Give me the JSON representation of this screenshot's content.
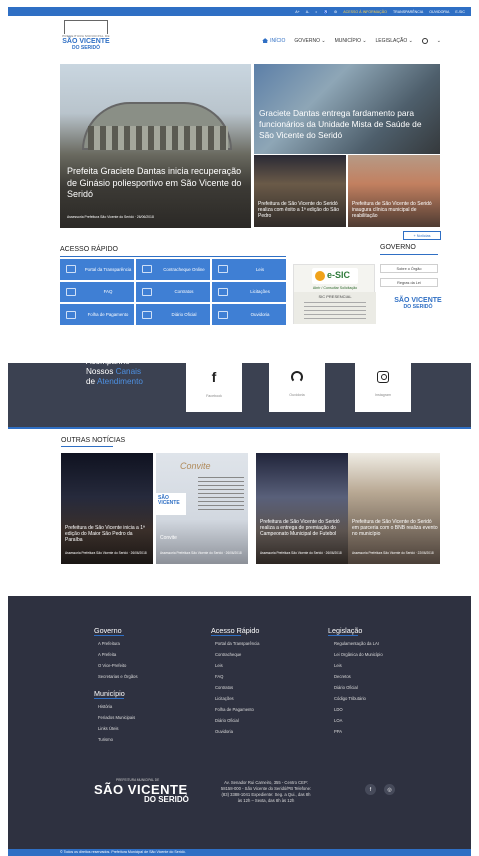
{
  "topbar": {
    "items": [
      "A+",
      "A-",
      "◐",
      "♿",
      "⚙"
    ],
    "links": [
      "ACESSO À INFORMAÇÃO",
      "TRANSPARÊNCIA",
      "OUVIDORIA",
      "E-SIC"
    ]
  },
  "header": {
    "logo_small": "PREFEITURA MUNICIPAL DE",
    "logo_main": "SÃO VICENTE",
    "logo_sub": "DO SERIDÓ",
    "nav": [
      {
        "label": "INÍCIO"
      },
      {
        "label": "GOVERNO ⌄"
      },
      {
        "label": "MUNICÍPIO ⌄"
      },
      {
        "label": "LEGISLAÇÃO ⌄"
      }
    ],
    "search_more": "⌄"
  },
  "hero": {
    "main": {
      "title": "Prefeita Graciete Dantas inicia recuperação de Ginásio poliesportivo em São Vicente do Seridó",
      "meta": "Assessoria Prefeitura São Vicente do Seridó · 26/06/2018"
    },
    "top_right": {
      "title": "Graciete Dantas entrega fardamento para funcionários da Unidade Mista de Saúde de São Vicente do Seridó"
    },
    "small": [
      {
        "title": "Prefeitura de São Vicente do Seridó realiza com êxito a 1ª edição do São Pedro"
      },
      {
        "title": "Prefeitura de São Vicente do Seridó inaugura clínica municipal de reabilitação"
      }
    ],
    "more_button": "+ Notícias"
  },
  "quick_access": {
    "title": "ACESSO RÁPIDO",
    "items": [
      {
        "label": "Portal da Transparência",
        "icon": "search-icon"
      },
      {
        "label": "Contracheque Online",
        "icon": "document-icon"
      },
      {
        "label": "Leis",
        "icon": "book-icon"
      },
      {
        "label": "FAQ",
        "icon": "chat-icon"
      },
      {
        "label": "Contratos",
        "icon": "contract-icon"
      },
      {
        "label": "Licitações",
        "icon": "gavel-icon"
      },
      {
        "label": "Folha de Pagamento",
        "icon": "payroll-icon"
      },
      {
        "label": "Diário Oficial",
        "icon": "newspaper-icon"
      },
      {
        "label": "Ouvidoria",
        "icon": "headset-icon"
      }
    ]
  },
  "esic": {
    "logo": "e-SIC",
    "caption": "Abrir / Consultar Solicitação",
    "presencial_title": "SIC PRESENCIAL"
  },
  "governo": {
    "title": "GOVERNO",
    "buttons": [
      "Sobre o Órgão",
      "Regras da Lei"
    ],
    "logo_main": "SÃO VICENTE",
    "logo_sub": "DO SERIDÓ"
  },
  "social": {
    "line1": "Acompanhe",
    "line2_a": "Nossos ",
    "line2_b": "Canais",
    "line3_a": "de ",
    "line3_b": "Atendimento",
    "channels": [
      {
        "glyph": "f",
        "label": "Facebook",
        "icon": "facebook-icon"
      },
      {
        "glyph": "",
        "label": "Ouvidoria",
        "icon": "podcast-icon"
      },
      {
        "glyph": "",
        "label": "Instagram",
        "icon": "instagram-icon"
      }
    ]
  },
  "outras": {
    "title": "OUTRAS NOTÍCIAS",
    "cards": [
      {
        "title": "Prefeitura de São Vicente inicia a 1ª edição do Maior São Pedro da Paraíba",
        "meta": "Assessoria Prefeitura São Vicente do Seridó · 26/06/2018"
      },
      {
        "title": "Convite",
        "meta": "Assessoria Prefeitura São Vicente do Seridó · 26/06/2018",
        "invite": "Convite"
      },
      {
        "title": "Prefeitura de São Vicente do Seridó realiza a entrega de premiação do Campeonato Municipal de Futebol",
        "meta": "Assessoria Prefeitura São Vicente do Seridó · 26/06/2018"
      },
      {
        "title": "Prefeitura de São Vicente do Seridó em parceria com o BNB realiza evento no município",
        "meta": "Assessoria Prefeitura São Vicente do Seridó · 22/06/2018"
      }
    ]
  },
  "footer": {
    "governo": {
      "title": "Governo",
      "links": [
        "A Prefeitura",
        "A Prefeita",
        "O Vice-Prefeito",
        "Secretarias e Órgãos"
      ]
    },
    "municipio": {
      "title": "Município",
      "links": [
        "História",
        "Feriados Municipais",
        "Links Úteis",
        "Turismo"
      ]
    },
    "acesso": {
      "title": "Acesso Rápido",
      "links": [
        "Portal da Transparência",
        "Contracheque",
        "Leis",
        "FAQ",
        "Contratos",
        "Licitações",
        "Folha de Pagamento",
        "Diário Oficial",
        "Ouvidoria"
      ]
    },
    "legislacao": {
      "title": "Legislação",
      "links": [
        "Regulamentação da LAI",
        "Lei Orgânica do Município",
        "Leis",
        "Decretos",
        "Diário Oficial",
        "Código Tributário",
        "LDO",
        "LOA",
        "PPA"
      ]
    },
    "logo_small": "PREFEITURA MUNICIPAL DE",
    "logo_main": "SÃO VICENTE",
    "logo_sub": "DO SERIDÓ",
    "address": "Av. Senador Rui Carneiro, 355 - Centro CEP: 58158-000 - São Vicente do Seridó/PB Telefone: (83) 3388-1041 Expediente: Seg. a Qui., das 8h às 12h – Sexta, das 8h às 12h",
    "social": [
      "f",
      "◎"
    ],
    "copyright": "© Todos os direitos reservados. Prefeitura Municipal de São Vicente do Seridó."
  }
}
